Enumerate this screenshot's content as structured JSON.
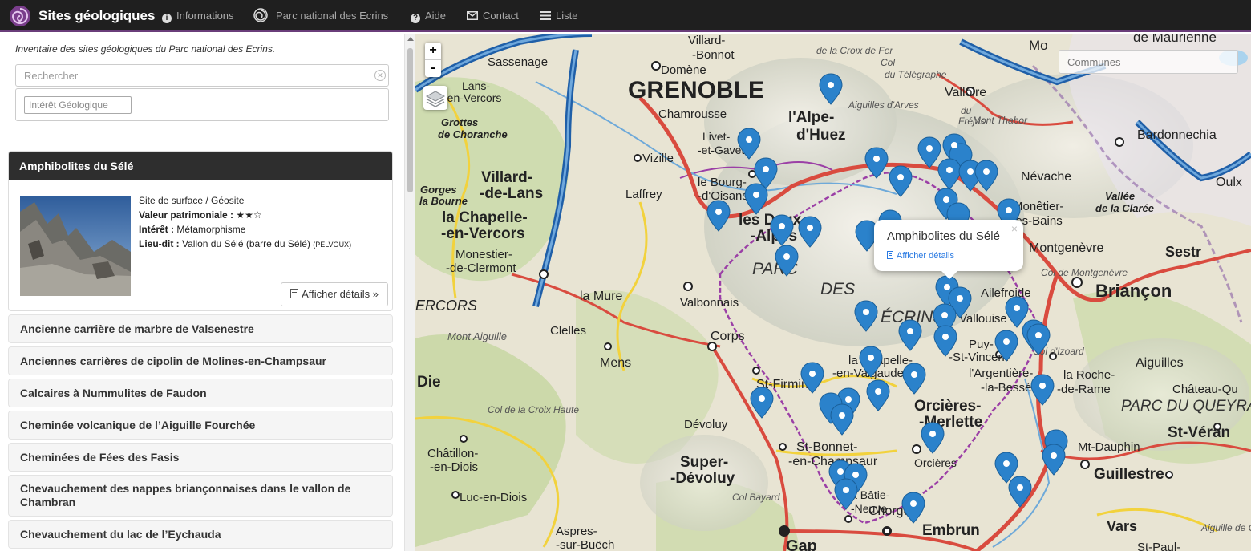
{
  "navbar": {
    "brand": "Sites géologiques",
    "links": [
      {
        "icon": "info-circle-icon",
        "label": "Informations"
      },
      {
        "icon": "park-logo-icon",
        "label": "Parc national des Ecrins"
      },
      {
        "icon": "question-circle-icon",
        "label": "Aide"
      },
      {
        "icon": "envelope-icon",
        "label": "Contact"
      },
      {
        "icon": "list-icon",
        "label": "Liste"
      }
    ],
    "colors": {
      "background": "#1f1f1f",
      "accent": "#6a3d7a"
    }
  },
  "sidebar": {
    "intro": "Inventaire des sites géologiques du Parc national des Ecrins.",
    "search_placeholder": "Rechercher",
    "filter_placeholder": "Intérêt Géologique",
    "selected_site": {
      "title": "Amphibolites du Sélé",
      "type": "Site de surface / Géosite",
      "valeur_label": "Valeur patrimoniale :",
      "valeur_stars": "★★☆",
      "interet_label": "Intérêt :",
      "interet": "Métamorphisme",
      "lieu_label": "Lieu-dit :",
      "lieu": "Vallon du Sélé (barre du Sélé)",
      "commune": "(PELVOUX)",
      "details_label": "Afficher détails »"
    },
    "items": [
      "Ancienne carrière de marbre de Valsenestre",
      "Anciennes carrières de cipolin de Molines-en-Champsaur",
      "Calcaires à Nummulites de Faudon",
      "Cheminée volcanique de l’Aiguille Fourchée",
      "Cheminées de Fées des Fasis",
      "Chevauchement des nappes briançonnaises dans le vallon de Chambran",
      "Chevauchement du lac de l’Eychauda"
    ]
  },
  "map": {
    "zoom_in": "+",
    "zoom_out": "-",
    "communes_placeholder": "Communes",
    "popup": {
      "title": "Amphibolites du Sélé",
      "link": "Afficher détails",
      "close": "×"
    },
    "labels": [
      "GRENOBLE",
      "l'Alpe-d'Huez",
      "les Deux-Alpes",
      "Briançon",
      "Orcières-Merlette",
      "Super-Dévoluy",
      "Gap",
      "Embrun",
      "Guillestre",
      "Vallouise",
      "Villard-de-Lans",
      "la Chapelle-en-Vercors",
      "Mens",
      "la Mure",
      "Corps",
      "St-Firmin",
      "St-Bonnet-en-Champsaur",
      "Chorges",
      "Névache",
      "Montgenèvre",
      "Valloire",
      "Bardonnechia",
      "PARC DES ÉCRINS",
      "PARC DU QUEYRAS",
      "Die",
      "Châtillon-en-Diois",
      "Luc-en-Diois",
      "Aspres-sur-Buëch",
      "Vizille",
      "Laffrey",
      "le Bourg-d'Oisans",
      "Chamrousse",
      "Domène",
      "Sassenage",
      "Villard-Bonnot",
      "Clelles",
      "Valbonnais",
      "Dévoluy",
      "la Chapelle-en-Valgaudemar",
      "Ailefroide",
      "l'Argentière-la-Bessée",
      "la Roche-de-Rame",
      "Mt-Dauphin",
      "Vars",
      "Aiguilles",
      "St-Véran",
      "Château-Queyras",
      "Oulx",
      "Vallée de la Clarée",
      "Monêtier-les-Bains",
      "Orcières",
      "la Bâtie-Neuve",
      "Puy-St-Vincent",
      "Livet-et-Gavet",
      "Lans-en-Vercors",
      "Monestier-de-Clermont"
    ]
  }
}
